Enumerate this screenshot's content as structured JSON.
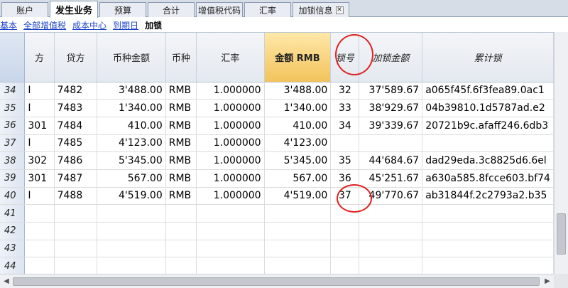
{
  "tabs": [
    {
      "label": "账户"
    },
    {
      "label": "发生业务"
    },
    {
      "label": "预算"
    },
    {
      "label": "合计"
    },
    {
      "label": "增值税代码"
    },
    {
      "label": "汇率"
    },
    {
      "label": "加锁信息"
    }
  ],
  "active_tab": "发生业务",
  "filters": {
    "basic": "基本",
    "all_vat": "全部增值税",
    "cost_center": "成本中心",
    "due_date": "到期日",
    "locked": "加锁"
  },
  "columns": [
    "",
    "方",
    "贷方",
    "币种金额",
    "币种",
    "汇率",
    "金额 RMB",
    "锁号",
    "加锁金额",
    "累计锁"
  ],
  "rows": [
    {
      "n": "34",
      "side": "I",
      "credit": "7482",
      "amount": "3'488.00",
      "cur": "RMB",
      "rate": "1.000000",
      "rmb": "3'488.00",
      "lock": "32",
      "lockamt": "37'589.67",
      "hash": "a065f45f.6f3fea89.0ac1"
    },
    {
      "n": "35",
      "side": "I",
      "credit": "7483",
      "amount": "1'340.00",
      "cur": "RMB",
      "rate": "1.000000",
      "rmb": "1'340.00",
      "lock": "33",
      "lockamt": "38'929.67",
      "hash": "04b39810.1d5787ad.e2"
    },
    {
      "n": "36",
      "side": "301",
      "credit": "7484",
      "amount": "410.00",
      "cur": "RMB",
      "rate": "1.000000",
      "rmb": "410.00",
      "lock": "34",
      "lockamt": "39'339.67",
      "hash": "20721b9c.afaff246.6db3"
    },
    {
      "n": "37",
      "side": "I",
      "credit": "7485",
      "amount": "4'123.00",
      "cur": "RMB",
      "rate": "1.000000",
      "rmb": "4'123.00",
      "lock": "",
      "lockamt": "",
      "hash": ""
    },
    {
      "n": "38",
      "side": "302",
      "credit": "7486",
      "amount": "5'345.00",
      "cur": "RMB",
      "rate": "1.000000",
      "rmb": "5'345.00",
      "lock": "35",
      "lockamt": "44'684.67",
      "hash": "dad29eda.3c8825d6.6el"
    },
    {
      "n": "39",
      "side": "301",
      "credit": "7487",
      "amount": "567.00",
      "cur": "RMB",
      "rate": "1.000000",
      "rmb": "567.00",
      "lock": "36",
      "lockamt": "45'251.67",
      "hash": "a630a585.8fcce603.bf74"
    },
    {
      "n": "40",
      "side": "I",
      "credit": "7488",
      "amount": "4'519.00",
      "cur": "RMB",
      "rate": "1.000000",
      "rmb": "4'519.00",
      "lock": "37",
      "lockamt": "49'770.67",
      "hash": "ab31844f.2c2793a2.b35"
    },
    {
      "n": "41",
      "side": "",
      "credit": "",
      "amount": "",
      "cur": "",
      "rate": "",
      "rmb": "",
      "lock": "",
      "lockamt": "",
      "hash": ""
    },
    {
      "n": "42",
      "side": "",
      "credit": "",
      "amount": "",
      "cur": "",
      "rate": "",
      "rmb": "",
      "lock": "",
      "lockamt": "",
      "hash": ""
    },
    {
      "n": "43",
      "side": "",
      "credit": "",
      "amount": "",
      "cur": "",
      "rate": "",
      "rmb": "",
      "lock": "",
      "lockamt": "",
      "hash": ""
    },
    {
      "n": "44",
      "side": "",
      "credit": "",
      "amount": "",
      "cur": "",
      "rate": "",
      "rmb": "",
      "lock": "",
      "lockamt": "",
      "hash": ""
    }
  ],
  "colors": {
    "highlight_header": "#f2c35c",
    "annotation_circle": "#e0201e",
    "link": "#1a44c8"
  }
}
